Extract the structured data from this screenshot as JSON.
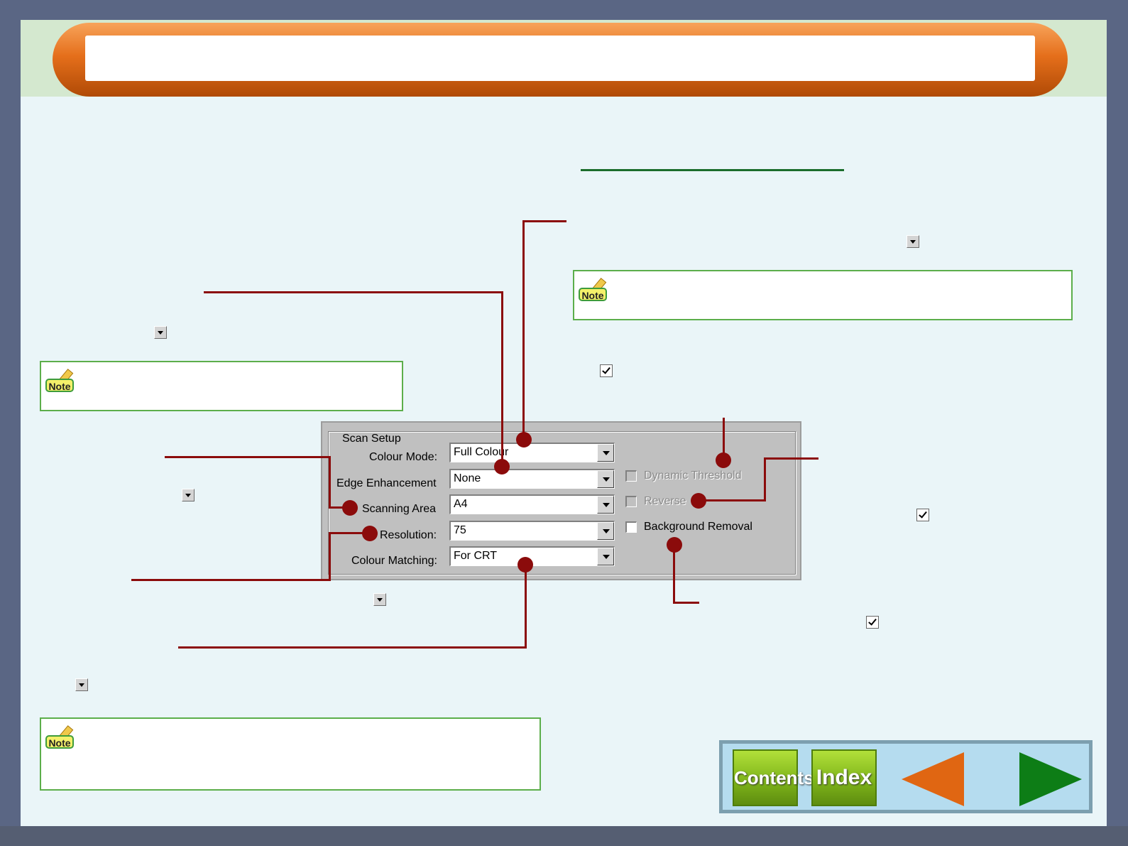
{
  "dialog": {
    "group_title": "Scan Setup",
    "labels": {
      "colour_mode": "Colour Mode:",
      "edge_enhancement": "Edge Enhancement",
      "scanning_area": "Scanning Area",
      "resolution": "Resolution:",
      "colour_matching": "Colour Matching:"
    },
    "values": {
      "colour_mode": "Full Colour",
      "edge_enhancement": "None",
      "scanning_area": "A4",
      "resolution": "75",
      "colour_matching": "For CRT"
    },
    "checkboxes": {
      "dynamic_threshold": "Dynamic Threshold",
      "reverse": "Reverse",
      "background_removal": "Background Removal"
    }
  },
  "notes": {
    "badge_label": "Note"
  },
  "nav": {
    "contents_label": "Contents",
    "index_label": "Index"
  },
  "colors": {
    "callout": "#8b0b0b",
    "header_orange": "#e56f1b",
    "nav_green": "#7fb51a"
  }
}
